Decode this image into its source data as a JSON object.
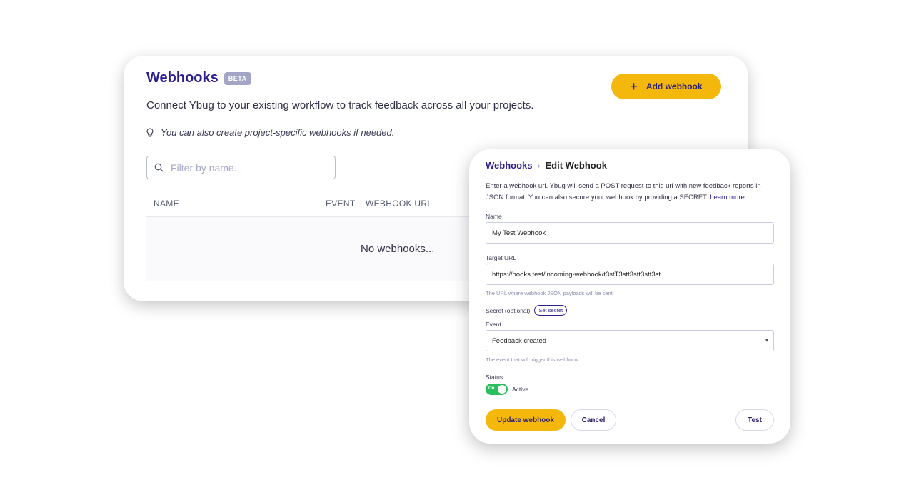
{
  "main": {
    "title": "Webhooks",
    "badge": "BETA",
    "add_button_label": "Add webhook",
    "subtitle": "Connect Ybug to your existing workflow to track feedback across all your projects.",
    "hint": "You can also create project-specific webhooks if needed.",
    "filter_placeholder": "Filter by name...",
    "columns": [
      "NAME",
      "EVENT",
      "WEBHOOK URL"
    ],
    "empty_message": "No webhooks..."
  },
  "edit": {
    "breadcrumb_root": "Webhooks",
    "breadcrumb_separator": "›",
    "breadcrumb_current": "Edit Webhook",
    "intro": "Enter a webhook url. Ybug will send a POST request to this url with new feedback reports in JSON format. You can also secure your webhook by providing a SECRET.",
    "learn_more": "Learn more.",
    "name_label": "Name",
    "name_value": "My Test Webhook",
    "url_label": "Target URL",
    "url_value": "https://hooks.test/incoming-webhook/t3stT3stt3stt3stt3st",
    "url_help": "The URL where webhook JSON payloads will be sent.",
    "secret_label": "Secret (optional)",
    "set_secret": "Set secret",
    "event_label": "Event",
    "event_value": "Feedback created",
    "event_arrow": "▾",
    "event_help": "The event that will trigger this webhook.",
    "status_label": "Status",
    "toggle_text": "On",
    "status_value": "Active",
    "update_button": "Update webhook",
    "cancel_button": "Cancel",
    "test_button": "Test"
  },
  "colors": {
    "brand": "#2c1f8f",
    "accent": "#f4b70c",
    "toggle_on": "#2bbf5c"
  }
}
